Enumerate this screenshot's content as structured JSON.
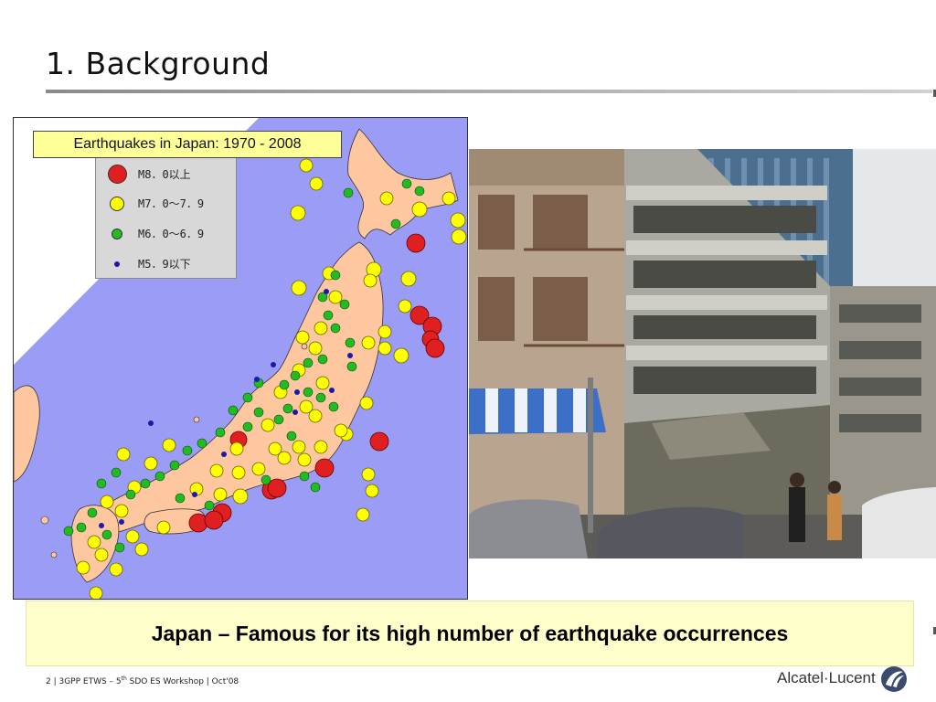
{
  "slide": {
    "title": "1. Background"
  },
  "map": {
    "caption": "Earthquakes in Japan: 1970 - 2008",
    "legend": [
      {
        "label": "M8．0以上",
        "color": "#e02020"
      },
      {
        "label": "M7．0〜7．9",
        "color": "#ffff00"
      },
      {
        "label": "M6．0〜6．9",
        "color": "#22bb22"
      },
      {
        "label": "M5．9以下",
        "color": "#1a1aa8"
      }
    ]
  },
  "banner": {
    "text": "Japan – Famous for its high number of earthquake occurrences"
  },
  "footer": {
    "prefix": "2 | 3GPP ETWS – 5",
    "sup": "th",
    "suffix": " SDO ES Workshop | Oct'08",
    "brand": "Alcatel·Lucent"
  },
  "colors": {
    "sea": "#9a9cf6",
    "land": "#fec7a0",
    "banner_bg": "#ffffcc",
    "caption_bg": "#ffff99"
  }
}
